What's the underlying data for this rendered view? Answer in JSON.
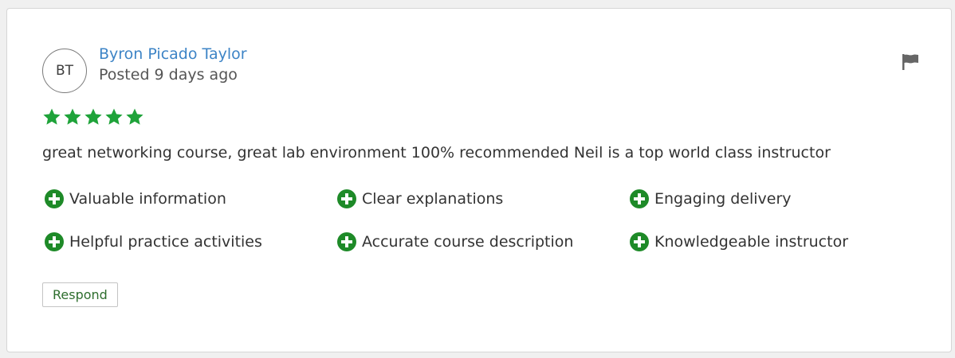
{
  "review": {
    "author": {
      "initials": "BT",
      "name": "Byron Picado Taylor",
      "posted": "Posted 9 days ago"
    },
    "rating": 5,
    "rating_max": 5,
    "comment": "great networking course, great lab environment 100% recommended Neil is a top world class instructor",
    "tags": [
      "Valuable information",
      "Clear explanations",
      "Engaging delivery",
      "Helpful practice activities",
      "Accurate course description",
      "Knowledgeable instructor"
    ],
    "respond_label": "Respond",
    "icons": {
      "star": "star-icon",
      "tag": "plus-circle-icon",
      "flag": "flag-icon"
    },
    "colors": {
      "star": "#1fa33a",
      "tag_icon": "#1e8a28",
      "author_link": "#3d84c6",
      "flag": "#666666"
    }
  }
}
